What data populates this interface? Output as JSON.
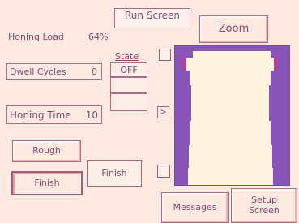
{
  "tab": {
    "label": "Run Screen"
  },
  "zoom_button": {
    "label": "Zoom"
  },
  "honing_load": {
    "label": "Honing Load",
    "value": "64%"
  },
  "dwell_cycles": {
    "label": "Dwell Cycles",
    "value": "0"
  },
  "honing_time": {
    "label": "Honing Time",
    "value": "10"
  },
  "state": {
    "header": "State",
    "values": [
      "OFF",
      "",
      ""
    ]
  },
  "arrow_button": {
    "label": ">"
  },
  "rough_button": {
    "label": "Rough"
  },
  "finish_button": {
    "label": "Finish"
  },
  "finish_status": {
    "label": "Finish"
  },
  "messages_button": {
    "label": "Messages"
  },
  "setup_button": {
    "label": "Setup\nScreen"
  },
  "colors": {
    "background": "#fde9e2",
    "gauge": "#8a55b8",
    "bore": "#fdf3df",
    "text": "#8a4a6e"
  }
}
